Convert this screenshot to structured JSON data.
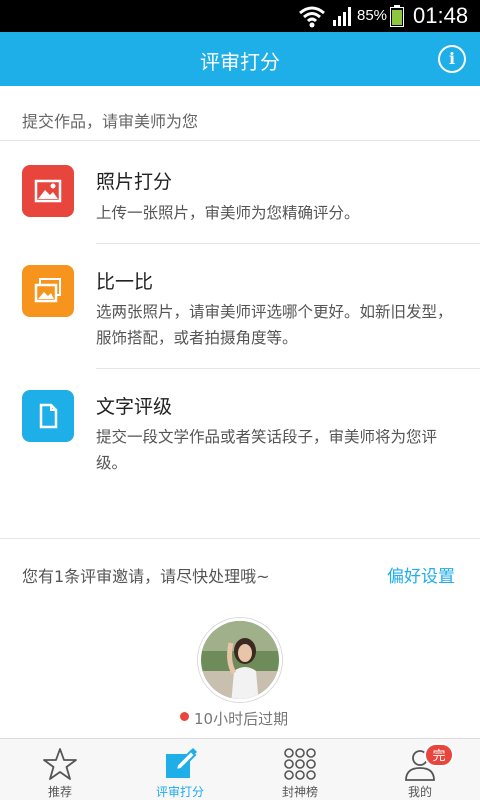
{
  "status_bar": {
    "battery_percent": "85%",
    "time": "01:48"
  },
  "header": {
    "title": "评审打分",
    "info_icon": "i"
  },
  "intro": "提交作品，请审美师为您",
  "options": [
    {
      "title": "照片打分",
      "desc": "上传一张照片，审美师为您精确评分。",
      "icon": "image-icon",
      "color": "#e8453c"
    },
    {
      "title": "比一比",
      "desc": "选两张照片，请审美师评选哪个更好。如新旧发型，服饰搭配，或者拍摄角度等。",
      "icon": "images-compare-icon",
      "color": "#f7941d"
    },
    {
      "title": "文字评级",
      "desc": "提交一段文学作品或者笑话段子，审美师将为您评级。",
      "icon": "document-icon",
      "color": "#1eaee8"
    }
  ],
  "invite": {
    "text": "您有1条评审邀请，请尽快处理哦~",
    "link": "偏好设置"
  },
  "expire": "10小时后过期",
  "tabs": [
    {
      "label": "推荐",
      "icon": "star-icon"
    },
    {
      "label": "评审打分",
      "icon": "edit-icon"
    },
    {
      "label": "封神榜",
      "icon": "grid-icon"
    },
    {
      "label": "我的",
      "icon": "user-icon"
    }
  ],
  "badge": "完",
  "colors": {
    "accent": "#1eaee8",
    "red": "#e8453c",
    "orange": "#f7941d"
  }
}
